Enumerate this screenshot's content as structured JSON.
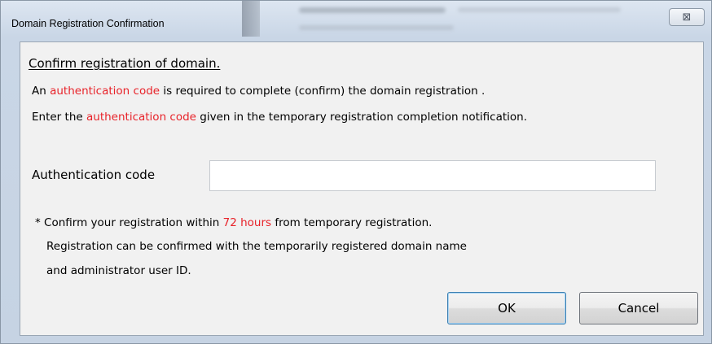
{
  "window": {
    "title": "Domain Registration Confirmation",
    "close_glyph": "⊠"
  },
  "content": {
    "heading": "Confirm registration of domain.",
    "line1": {
      "prefix": "An ",
      "highlight": "authentication code",
      "suffix": " is required to complete (confirm) the domain registration ."
    },
    "line2": {
      "prefix": "Enter the ",
      "highlight": "authentication code",
      "suffix": " given in the temporary registration completion notification."
    },
    "auth_field": {
      "label": "Authentication code",
      "value": "",
      "placeholder": ""
    },
    "note": {
      "line1_prefix": "* Confirm your registration within ",
      "line1_highlight": "72 hours",
      "line1_suffix": " from temporary registration.",
      "line2": "Registration can be confirmed with the temporarily registered domain name",
      "line3": "and administrator user ID."
    },
    "buttons": {
      "ok_label": "OK",
      "cancel_label": "Cancel"
    }
  },
  "colors": {
    "highlight": "#e8232a",
    "panel_bg": "#f1f1f1",
    "frame_bg": "#c9d6e6"
  }
}
